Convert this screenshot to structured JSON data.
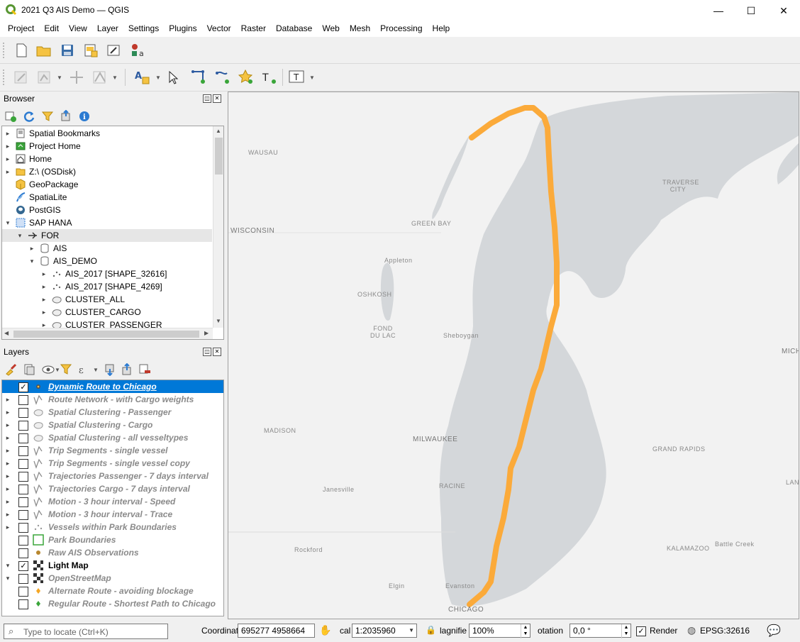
{
  "window": {
    "title": "2021 Q3 AIS Demo — QGIS",
    "buttons": [
      "—",
      "☐",
      "✕"
    ]
  },
  "menu": [
    "Project",
    "Edit",
    "View",
    "Layer",
    "Settings",
    "Plugins",
    "Vector",
    "Raster",
    "Database",
    "Web",
    "Mesh",
    "Processing",
    "Help"
  ],
  "browser": {
    "title": "Browser",
    "items": [
      {
        "label": "Spatial Bookmarks",
        "icon": "bookmarks-icon",
        "indent": 0,
        "arrow": "▸"
      },
      {
        "label": "Project Home",
        "icon": "project-home-icon",
        "indent": 0,
        "arrow": "▸"
      },
      {
        "label": "Home",
        "icon": "home-icon",
        "indent": 0,
        "arrow": "▸"
      },
      {
        "label": "Z:\\ (OSDisk)",
        "icon": "drive-icon",
        "indent": 0,
        "arrow": "▸"
      },
      {
        "label": "GeoPackage",
        "icon": "geopackage-icon",
        "indent": 0,
        "arrow": ""
      },
      {
        "label": "SpatiaLite",
        "icon": "spatialite-icon",
        "indent": 0,
        "arrow": ""
      },
      {
        "label": "PostGIS",
        "icon": "postgis-icon",
        "indent": 0,
        "arrow": ""
      },
      {
        "label": "SAP HANA",
        "icon": "sap-hana-icon",
        "indent": 0,
        "arrow": "▾"
      },
      {
        "label": "FOR",
        "icon": "connection-icon",
        "indent": 1,
        "arrow": "▾"
      },
      {
        "label": "AIS",
        "icon": "schema-icon",
        "indent": 2,
        "arrow": "▸"
      },
      {
        "label": "AIS_DEMO",
        "icon": "schema-icon",
        "indent": 2,
        "arrow": "▾"
      },
      {
        "label": "AIS_2017 [SHAPE_32616]",
        "icon": "point-layer-icon",
        "indent": 3,
        "arrow": "▸"
      },
      {
        "label": "AIS_2017 [SHAPE_4269]",
        "icon": "point-layer-icon",
        "indent": 3,
        "arrow": "▸"
      },
      {
        "label": "CLUSTER_ALL",
        "icon": "polygon-layer-icon",
        "indent": 3,
        "arrow": "▸"
      },
      {
        "label": "CLUSTER_CARGO",
        "icon": "polygon-layer-icon",
        "indent": 3,
        "arrow": "▸"
      },
      {
        "label": "CLUSTER_PASSENGER",
        "icon": "polygon-layer-icon",
        "indent": 3,
        "arrow": "▸"
      }
    ]
  },
  "layers": {
    "title": "Layers",
    "items": [
      {
        "label": "Dynamic Route to Chicago",
        "icon": "point-style-icon",
        "checked": true,
        "arrow": "",
        "state": "sel"
      },
      {
        "label": "Route Network - with Cargo weights",
        "icon": "line-style-icon",
        "checked": false,
        "arrow": "▸",
        "state": "off"
      },
      {
        "label": "Spatial Clustering - Passenger",
        "icon": "polygon-style-icon",
        "checked": false,
        "arrow": "▸",
        "state": "off"
      },
      {
        "label": "Spatial Clustering - Cargo",
        "icon": "polygon-style-icon",
        "checked": false,
        "arrow": "▸",
        "state": "off"
      },
      {
        "label": "Spatial Clustering - all vesseltypes",
        "icon": "polygon-style-icon",
        "checked": false,
        "arrow": "▸",
        "state": "off"
      },
      {
        "label": "Trip Segments - single vessel",
        "icon": "line-style-icon",
        "checked": false,
        "arrow": "▸",
        "state": "off"
      },
      {
        "label": "Trip Segments - single vessel copy",
        "icon": "line-style-icon",
        "checked": false,
        "arrow": "▸",
        "state": "off"
      },
      {
        "label": "Trajectories Passenger - 7 days interval",
        "icon": "line-style-icon",
        "checked": false,
        "arrow": "▸",
        "state": "off"
      },
      {
        "label": "Trajectories Cargo - 7 days interval",
        "icon": "line-style-icon",
        "checked": false,
        "arrow": "▸",
        "state": "off"
      },
      {
        "label": "Motion - 3 hour interval - Speed",
        "icon": "line-style-icon",
        "checked": false,
        "arrow": "▸",
        "state": "off"
      },
      {
        "label": "Motion - 3 hour interval - Trace",
        "icon": "line-style-icon",
        "checked": false,
        "arrow": "▸",
        "state": "off"
      },
      {
        "label": "Vessels within Park Boundaries",
        "icon": "point-cluster-icon",
        "checked": false,
        "arrow": "▸",
        "state": "off"
      },
      {
        "label": "Park Boundaries",
        "icon": "green-square-icon",
        "checked": false,
        "arrow": "",
        "state": "off"
      },
      {
        "label": "Raw AIS Observations",
        "icon": "brown-dot-icon",
        "checked": false,
        "arrow": "",
        "state": "off"
      },
      {
        "label": "Light Map",
        "icon": "raster-icon",
        "checked": true,
        "arrow": "▾",
        "state": "on"
      },
      {
        "label": "OpenStreetMap",
        "icon": "raster-icon",
        "checked": false,
        "arrow": "▾",
        "state": "off"
      },
      {
        "label": "Alternate Route - avoiding blockage",
        "icon": "orange-dot-icon",
        "checked": false,
        "arrow": "",
        "state": "off"
      },
      {
        "label": "Regular Route - Shortest Path to Chicago",
        "icon": "green-dot-icon",
        "checked": false,
        "arrow": "",
        "state": "off"
      }
    ]
  },
  "map": {
    "labels": [
      {
        "text": "WAUSAU",
        "cls": ""
      },
      {
        "text": "WISCONSIN",
        "cls": "city"
      },
      {
        "text": "GREEN BAY",
        "cls": ""
      },
      {
        "text": "Appleton",
        "cls": ""
      },
      {
        "text": "OSHKOSH",
        "cls": ""
      },
      {
        "text": "FOND DU LAC",
        "cls": ""
      },
      {
        "text": "Sheboygan",
        "cls": ""
      },
      {
        "text": "MADISON",
        "cls": ""
      },
      {
        "text": "MILWAUKEE",
        "cls": "city"
      },
      {
        "text": "Janesville",
        "cls": ""
      },
      {
        "text": "RACINE",
        "cls": ""
      },
      {
        "text": "Rockford",
        "cls": ""
      },
      {
        "text": "Elgin",
        "cls": ""
      },
      {
        "text": "Evanston",
        "cls": ""
      },
      {
        "text": "CHICAGO",
        "cls": "city"
      },
      {
        "text": "TRAVERSE CITY",
        "cls": ""
      },
      {
        "text": "MICHIGA",
        "cls": "city"
      },
      {
        "text": "GRAND RAPIDS",
        "cls": ""
      },
      {
        "text": "KALAMAZOO",
        "cls": ""
      },
      {
        "text": "Battle Creek",
        "cls": ""
      },
      {
        "text": "LAN",
        "cls": ""
      }
    ],
    "route_color": "#fbaa3a",
    "water_color": "#d4d7da",
    "land_color": "#f2f2f2"
  },
  "status": {
    "locate_placeholder": "Type to locate (Ctrl+K)",
    "coordinate_label": "Coordinat",
    "coordinate_value": "695277 4958664",
    "scale_label": "cal",
    "scale_value": "1:2035960",
    "magnifier_label": "lagnifie",
    "magnifier_value": "100%",
    "rotation_label": "otation",
    "rotation_value": "0,0 °",
    "render_label": "Render",
    "crs": "EPSG:32616"
  }
}
